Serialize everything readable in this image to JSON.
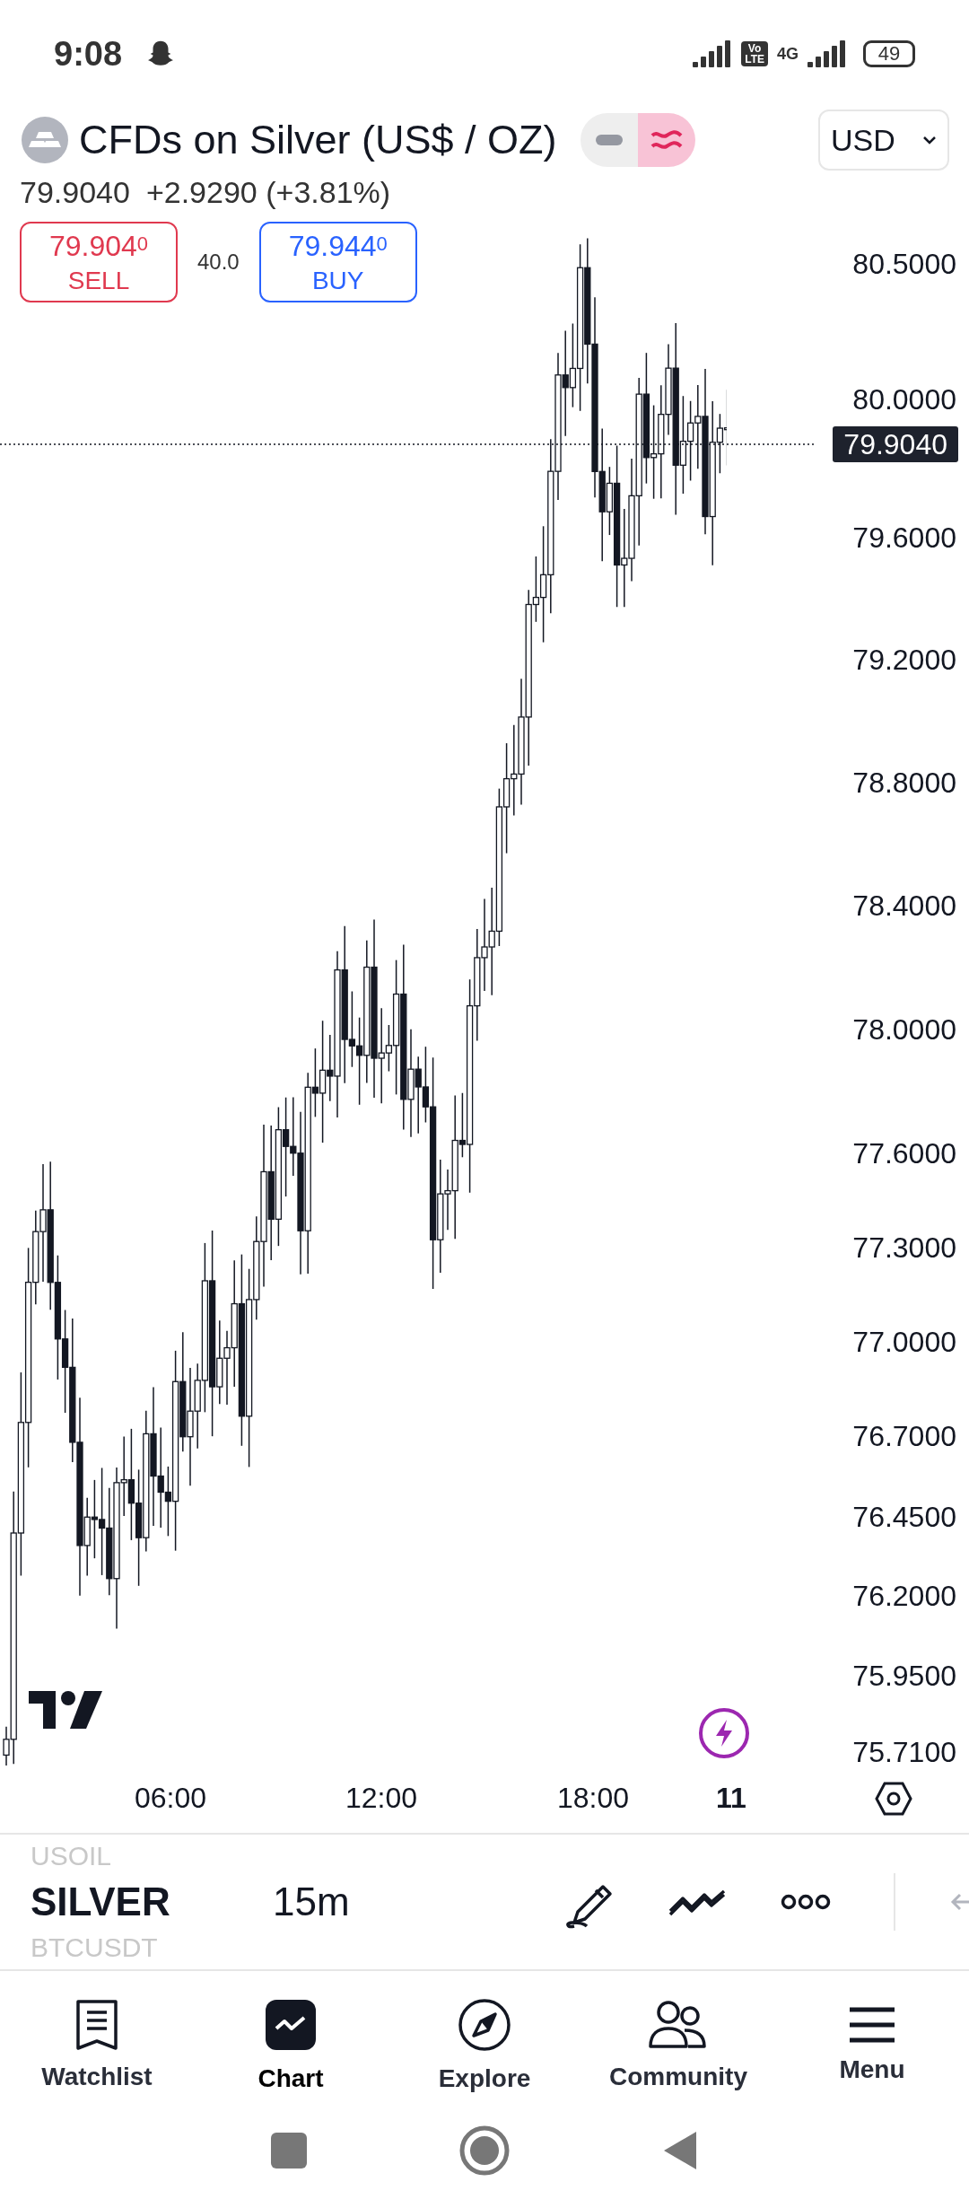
{
  "status_bar": {
    "time": "9:08",
    "volte_badge": [
      "Vo",
      "LTE"
    ],
    "network": "4G",
    "battery": "49"
  },
  "header": {
    "title": "CFDs on Silver (US$ / OZ)",
    "mode_toggle": [
      {
        "selected": false
      },
      {
        "selected": true
      }
    ],
    "currency": "USD",
    "price": "79.9040",
    "change": "+2.9290 (+3.81%)"
  },
  "trade": {
    "sell": {
      "price": "79.904$^{0}$",
      "label": "SELL"
    },
    "spread": "40.0",
    "buy": {
      "price": "79.944$^{0}$",
      "label": "BUY"
    }
  },
  "chart": {
    "price_axis": [
      "80.5000",
      "80.0000",
      "79.6000",
      "79.2000",
      "78.8000",
      "78.4000",
      "78.0000",
      "77.6000",
      "77.3000",
      "77.0000",
      "76.7000",
      "76.4500",
      "76.2000",
      "75.9500",
      "75.7100"
    ],
    "last_price": "79.9040",
    "time_axis": [
      {
        "label": "06:00",
        "kind": "time"
      },
      {
        "label": "12:00",
        "kind": "time"
      },
      {
        "label": "18:00",
        "kind": "time"
      },
      {
        "label": "11",
        "kind": "day"
      }
    ]
  },
  "toolbar": {
    "symbols": [
      {
        "label": "USOIL",
        "selected": false
      },
      {
        "label": "SILVER",
        "selected": true
      },
      {
        "label": "BTCUSDT",
        "selected": false
      }
    ],
    "interval": "15m"
  },
  "nav": [
    {
      "label": "Watchlist",
      "selected": false
    },
    {
      "label": "Chart",
      "selected": true
    },
    {
      "label": "Explore",
      "selected": false
    },
    {
      "label": "Community",
      "selected": false
    },
    {
      "label": "Menu",
      "selected": false
    }
  ]
}
